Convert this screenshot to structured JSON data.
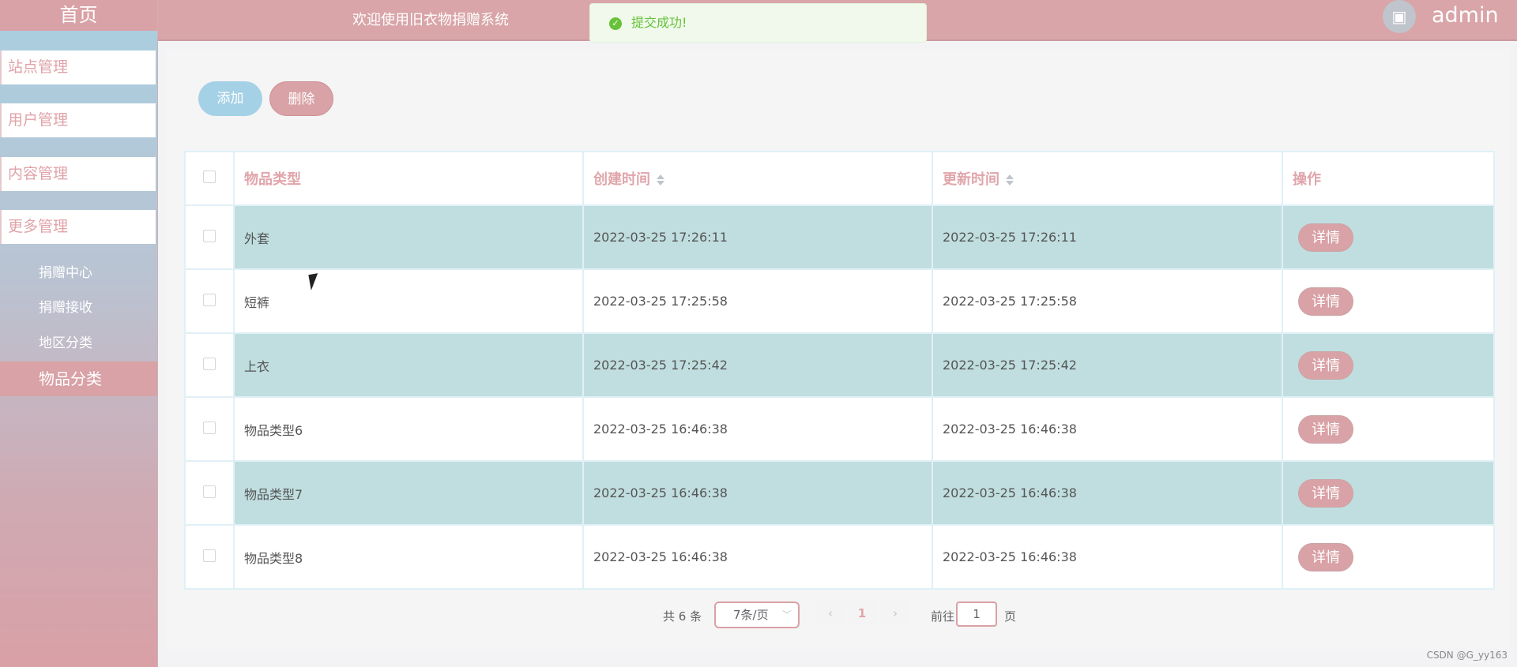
{
  "sidebar": {
    "home": "首页",
    "menus": [
      "站点管理",
      "用户管理",
      "内容管理",
      "更多管理"
    ],
    "submenus": [
      "捐赠中心",
      "捐赠接收",
      "地区分类",
      "物品分类"
    ],
    "active": "物品分类"
  },
  "header": {
    "welcome": "欢迎使用旧衣物捐赠系统",
    "username": "admin",
    "toast": "提交成功!"
  },
  "toolbar": {
    "add_label": "添加",
    "delete_label": "删除"
  },
  "table": {
    "columns": [
      "物品类型",
      "创建时间",
      "更新时间",
      "操作"
    ],
    "rows": [
      {
        "type": "外套",
        "created": "2022-03-25 17:26:11",
        "updated": "2022-03-25 17:26:11",
        "action": "详情"
      },
      {
        "type": "短裤",
        "created": "2022-03-25 17:25:58",
        "updated": "2022-03-25 17:25:58",
        "action": "详情"
      },
      {
        "type": "上衣",
        "created": "2022-03-25 17:25:42",
        "updated": "2022-03-25 17:25:42",
        "action": "详情"
      },
      {
        "type": "物品类型6",
        "created": "2022-03-25 16:46:38",
        "updated": "2022-03-25 16:46:38",
        "action": "详情"
      },
      {
        "type": "物品类型7",
        "created": "2022-03-25 16:46:38",
        "updated": "2022-03-25 16:46:38",
        "action": "详情"
      },
      {
        "type": "物品类型8",
        "created": "2022-03-25 16:46:38",
        "updated": "2022-03-25 16:46:38",
        "action": "详情"
      }
    ]
  },
  "pagination": {
    "total": "共 6 条",
    "page_size": "7条/页",
    "current_page": "1",
    "goto_label": "前往",
    "goto_value": "1",
    "page_unit": "页"
  },
  "watermark": "CSDN @G_yy163",
  "colors": {
    "accent_pink": "#d9a2a6",
    "accent_blue": "#a5d1e6",
    "row_tint": "#c0dee0",
    "success": "#67c23a"
  }
}
